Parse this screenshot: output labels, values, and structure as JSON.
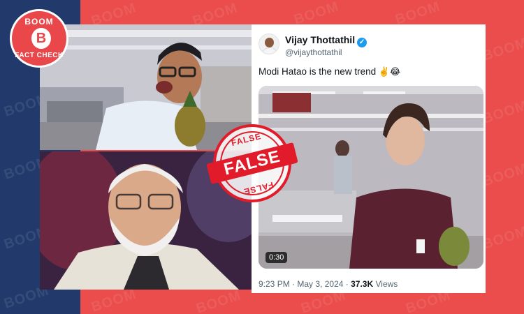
{
  "brand": {
    "logo_top": "BOOM",
    "logo_letter": "B",
    "logo_bottom": "FACT CHECK",
    "watermark": "BOOM"
  },
  "stamp": {
    "top": "FALSE",
    "banner": "FALSE",
    "bottom": "FALSE",
    "color": "#e21b2a"
  },
  "tweet": {
    "display_name": "Vijay Thottathil",
    "verified_icon": "verified-badge-icon",
    "handle": "@vijaythottathil",
    "text": "Modi Hatao is the new trend",
    "emojis": "✌️😂",
    "video_duration": "0:30",
    "time": "9:23 PM",
    "separator": "·",
    "date": "May 3, 2024",
    "views_count": "37.3K",
    "views_label": "Views"
  },
  "colors": {
    "navy": "#213a6b",
    "red": "#ea4d4b",
    "twitter_blue": "#1d9bf0"
  }
}
